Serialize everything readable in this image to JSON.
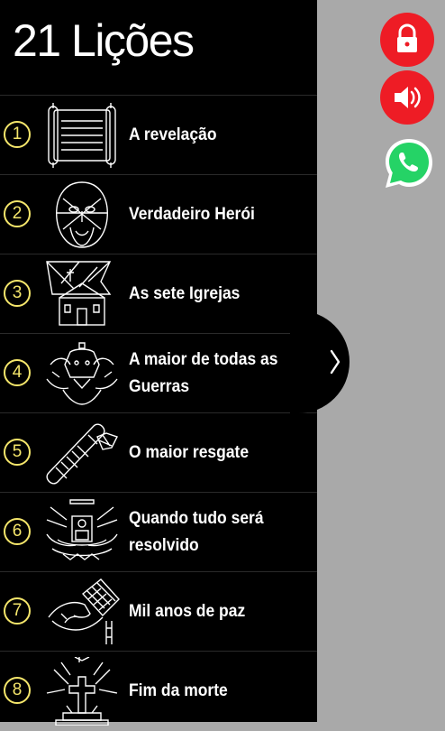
{
  "header": {
    "title": "21 Lições"
  },
  "lessons": [
    {
      "number": "1",
      "title": "A revelação",
      "icon": "scroll-icon"
    },
    {
      "number": "2",
      "title": "Verdadeiro Herói",
      "icon": "jesus-face-icon"
    },
    {
      "number": "3",
      "title": "As sete Igrejas",
      "icon": "church-icon"
    },
    {
      "number": "4",
      "title": "A maior de todas as Guerras",
      "icon": "beasts-icon"
    },
    {
      "number": "5",
      "title": "O maior resgate",
      "icon": "rolled-scroll-icon"
    },
    {
      "number": "6",
      "title": "Quando tudo será resolvido",
      "icon": "throne-icon"
    },
    {
      "number": "7",
      "title": "Mil anos de paz",
      "icon": "hand-net-icon"
    },
    {
      "number": "8",
      "title": "Fim da morte",
      "icon": "tomb-cross-icon"
    }
  ],
  "actions": {
    "lock": {
      "icon": "lock-icon",
      "color": "#ee1c25"
    },
    "sound": {
      "icon": "speaker-icon",
      "color": "#ee1c25"
    },
    "whatsapp": {
      "icon": "whatsapp-icon",
      "color": "#25d366"
    }
  },
  "drawer": {
    "toggle_icon": "chevron-right-icon"
  }
}
